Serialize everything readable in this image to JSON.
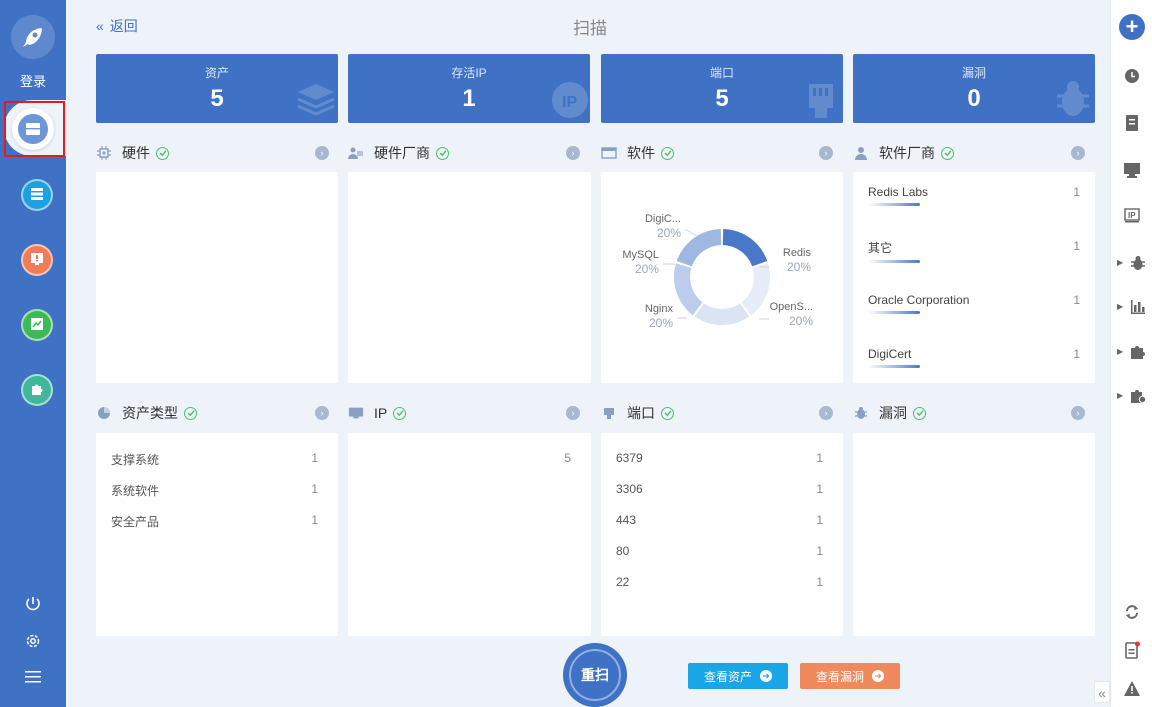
{
  "sidebar": {
    "login_label": "登录"
  },
  "header": {
    "back_label": "返回",
    "title": "扫描"
  },
  "stats": [
    {
      "label": "资产",
      "value": "5"
    },
    {
      "label": "存活IP",
      "value": "1"
    },
    {
      "label": "端口",
      "value": "5"
    },
    {
      "label": "漏洞",
      "value": "0"
    }
  ],
  "sections": {
    "hardware": {
      "title": "硬件"
    },
    "hardware_vendor": {
      "title": "硬件厂商"
    },
    "software": {
      "title": "软件"
    },
    "software_vendor": {
      "title": "软件厂商",
      "items": [
        {
          "name": "Redis Labs",
          "count": "1"
        },
        {
          "name": "其它",
          "count": "1"
        },
        {
          "name": "Oracle Corporation",
          "count": "1"
        },
        {
          "name": "DigiCert",
          "count": "1"
        }
      ]
    },
    "asset_type": {
      "title": "资产类型",
      "items": [
        {
          "name": "支撑系统",
          "count": "1"
        },
        {
          "name": "系统软件",
          "count": "1"
        },
        {
          "name": "安全产品",
          "count": "1"
        }
      ]
    },
    "ip": {
      "title": "IP",
      "items": [
        {
          "name": "",
          "count": "5"
        }
      ]
    },
    "port": {
      "title": "端口",
      "items": [
        {
          "name": "6379",
          "count": "1"
        },
        {
          "name": "3306",
          "count": "1"
        },
        {
          "name": "443",
          "count": "1"
        },
        {
          "name": "80",
          "count": "1"
        },
        {
          "name": "22",
          "count": "1"
        }
      ]
    },
    "vuln": {
      "title": "漏洞"
    }
  },
  "chart_data": {
    "type": "pie",
    "donut": true,
    "categories": [
      "Redis",
      "OpenS...",
      "Nginx",
      "MySQL",
      "DigiC..."
    ],
    "values": [
      20,
      20,
      20,
      20,
      20
    ],
    "value_labels": [
      "20%",
      "20%",
      "20%",
      "20%",
      "20%"
    ],
    "colors": [
      "#e7edf8",
      "#dbe4f4",
      "#bccdeb",
      "#9fb8e2",
      "#4a78c8"
    ]
  },
  "footer": {
    "rescan_label": "重扫",
    "view_assets_label": "查看资产",
    "view_vulns_label": "查看漏洞"
  },
  "colors": {
    "primary": "#3f72c4",
    "success": "#4cbf6c",
    "cyan_button": "#1aa6e6",
    "orange_button": "#f08a5c"
  }
}
